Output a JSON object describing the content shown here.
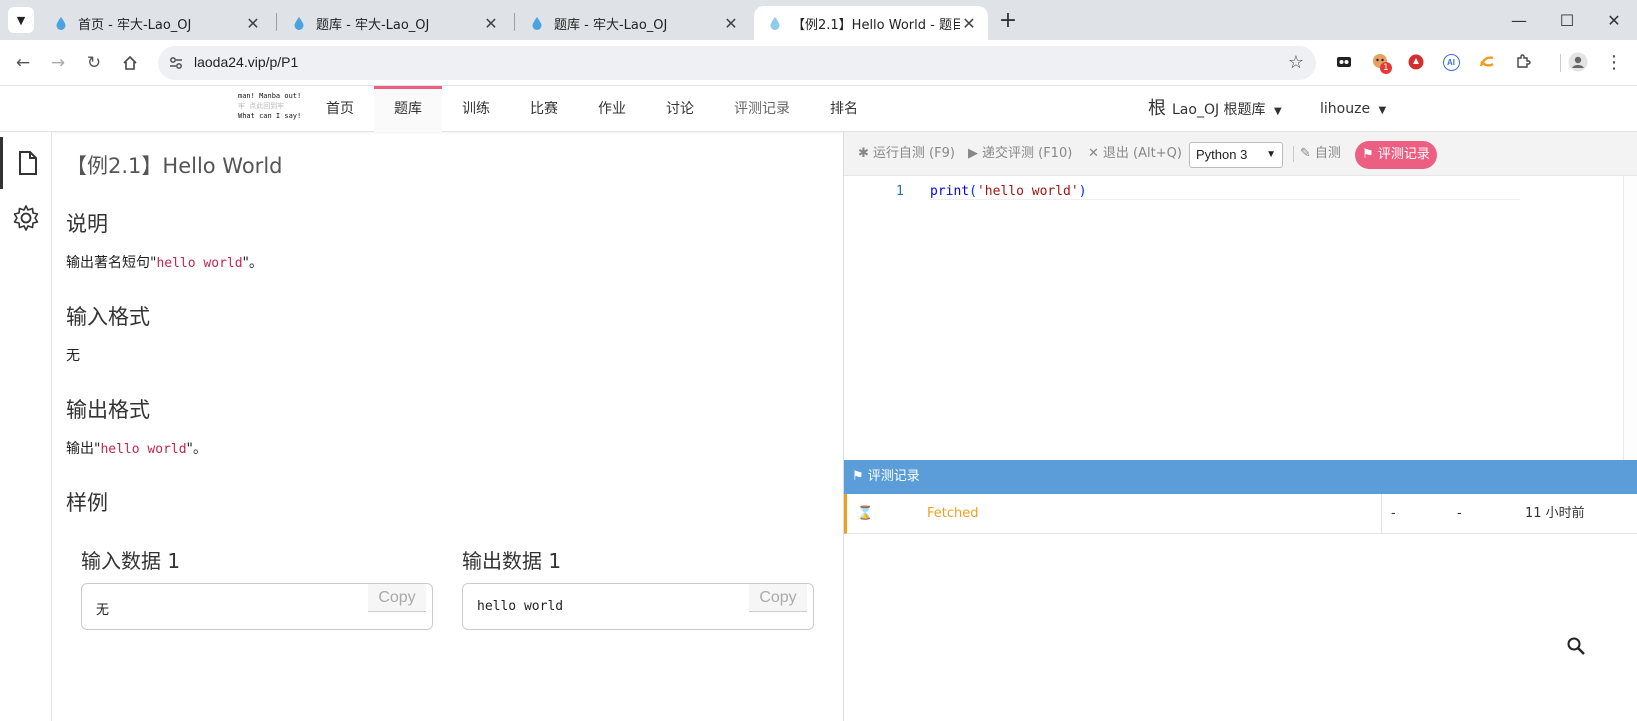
{
  "browser": {
    "tabs": [
      {
        "label": "首页 - 牢大-Lao_OJ",
        "icon": "droplet-icon"
      },
      {
        "label": "题库 - 牢大-Lao_OJ",
        "icon": "droplet-icon"
      },
      {
        "label": "题库 - 牢大-Lao_OJ",
        "icon": "droplet-icon"
      },
      {
        "label": "【例2.1】Hello World - 题目详",
        "icon": "droplet-icon",
        "active": true
      }
    ],
    "new_tab_label": "+",
    "url": "laoda24.vip/p/P1",
    "extension_badge": "1",
    "extension_ai_label": "AI"
  },
  "site": {
    "logo_lines": [
      "man! Manba out!",
      "牢 点此回到牢",
      "What can I say!"
    ],
    "nav": [
      "首页",
      "题库",
      "训练",
      "比赛",
      "作业",
      "讨论",
      "评测记录",
      "排名"
    ],
    "active_nav": "题库",
    "domain_glyph": "根",
    "domain_label": "Lao_OJ 根题库",
    "user": "lihouze"
  },
  "problem": {
    "title": "【例2.1】Hello World",
    "sections": {
      "desc_heading": "说明",
      "desc_prefix": "输出著名短句\"",
      "desc_code": "hello world",
      "desc_suffix": "\"。",
      "input_heading": "输入格式",
      "input_text": "无",
      "output_heading": "输出格式",
      "output_prefix": "输出\"",
      "output_code": "hello world",
      "output_suffix": "\"。",
      "sample_heading": "样例"
    },
    "samples": {
      "input_heading": "输入数据 1",
      "input_value": "无",
      "output_heading": "输出数据 1",
      "output_value": "hello world",
      "copy_label": "Copy"
    }
  },
  "editor": {
    "toolbar": {
      "run_label": "运行自测 (F9)",
      "submit_label": "递交评测 (F10)",
      "exit_label": "退出 (Alt+Q)",
      "language": "Python 3",
      "selftest_label": "自测",
      "records_label": "评测记录"
    },
    "code": {
      "line_number": "1",
      "fn": "print",
      "open": "(",
      "str": "'hello world'",
      "close": ")"
    },
    "judge": {
      "header": "评测记录",
      "status": "Fetched",
      "col_a": "-",
      "col_b": "-",
      "time": "11 小时前"
    }
  },
  "colors": {
    "accent": "#ed5f82",
    "judge_header": "#5b9dd9",
    "pending": "#f0a020",
    "code_string": "#c7254e"
  }
}
